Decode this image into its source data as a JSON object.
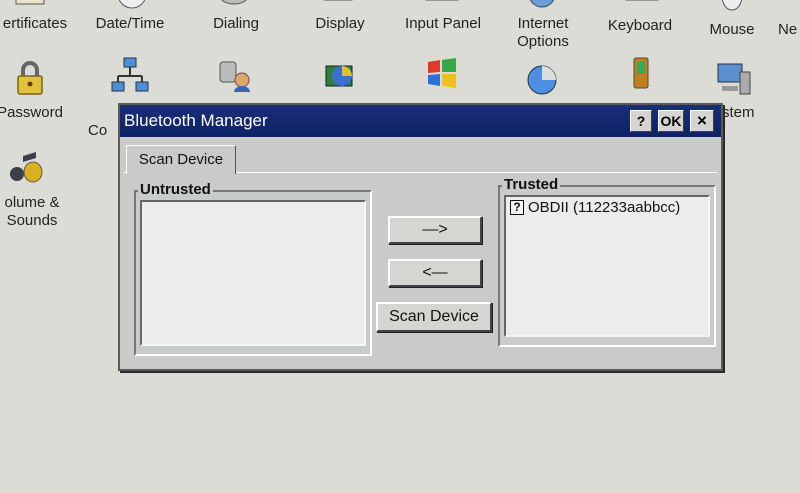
{
  "control_panel": {
    "row1": [
      {
        "label": "ertificates",
        "icon": "certificates-icon"
      },
      {
        "label": "Date/Time",
        "icon": "clock-icon"
      },
      {
        "label": "Dialing",
        "icon": "phone-icon"
      },
      {
        "label": "Display",
        "icon": "monitor-icon"
      },
      {
        "label": "Input Panel",
        "icon": "keyboard-panel-icon"
      },
      {
        "label": "Internet Options",
        "icon": "globe-icon"
      },
      {
        "label": "Keyboard",
        "icon": "keyboard-icon"
      },
      {
        "label": "Mouse",
        "icon": "mouse-icon"
      },
      {
        "label": "Ne Di",
        "icon": "network-icon"
      }
    ],
    "row2": [
      {
        "label": "Password",
        "icon": "padlock-icon"
      },
      {
        "label": "Co",
        "icon": "network-connections-icon"
      },
      {
        "label": "",
        "icon": "owner-icon"
      },
      {
        "label": "",
        "icon": "power-icon"
      },
      {
        "label": "",
        "icon": "windows-logo-icon"
      },
      {
        "label": "",
        "icon": "regional-settings-icon"
      },
      {
        "label": "",
        "icon": "stylus-icon"
      },
      {
        "label": "stem",
        "icon": "system-icon"
      }
    ],
    "row3": [
      {
        "label": "olume & Sounds",
        "icon": "speaker-note-icon"
      }
    ]
  },
  "dialog": {
    "title": "Bluetooth Manager",
    "help_label": "?",
    "ok_label": "OK",
    "close_label": "×",
    "tab_label": "Scan Device",
    "untrusted_label": "Untrusted",
    "trusted_label": "Trusted",
    "untrusted_devices": [],
    "trusted_devices": [
      {
        "name": "OBDII (112233aabbcc)"
      }
    ],
    "move_right_label": "—>",
    "move_left_label": "<—",
    "scan_button_label": "Scan Device"
  },
  "colors": {
    "titlebar": "#0e2266",
    "dialog_bg": "#c9cbc8",
    "desktop_bg": "#dcdcd6"
  }
}
